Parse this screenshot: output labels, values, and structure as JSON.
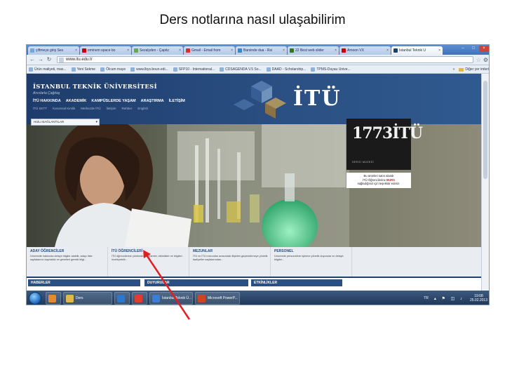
{
  "slide": {
    "title": "Ders notlarına nasıl ulaşabilirim"
  },
  "browser": {
    "tabs": [
      {
        "label": "çiftmeye giriş Ses",
        "icon_color": "#6fa8dc",
        "active": false
      },
      {
        "label": "eminem space bo",
        "icon_color": "#cc0000",
        "active": false
      },
      {
        "label": "Sezalyden - Çapitz",
        "icon_color": "#6aa84f",
        "active": false
      },
      {
        "label": "Gmail - Email from",
        "icon_color": "#d93025",
        "active": false
      },
      {
        "label": "Barsinde dua - Rsi",
        "icon_color": "#3d85c6",
        "active": false
      },
      {
        "label": "22 Best web slider",
        "icon_color": "#38761d",
        "active": false
      },
      {
        "label": "Amoon VX",
        "icon_color": "#cc0000",
        "active": false
      },
      {
        "label": "İstanbul Teknik Ü",
        "icon_color": "#1f3f6e",
        "active": true
      }
    ],
    "url": "www.itu.edu.tr",
    "bookmarks": [
      "Ürün maliyeti, mas...",
      "Yeni Sekme",
      "Ölcum maye",
      "www.lbys.boun.edi...",
      "SFP10 - International...",
      "CDSAGENDA V.5 So...",
      "DAAD - Scholarship...",
      "TPMS-Duyau Unive..."
    ],
    "bookmarks_more": "Diğer yer imleri"
  },
  "site": {
    "name": "İSTANBUL TEKNİK ÜNİVERSİTESİ",
    "subtitle": "Arıcılarla Çağdaş",
    "nav": [
      "İTÜ HAKKINDA",
      "AKADEMİK",
      "KAMPÜSLERDE YAŞAM",
      "ARAŞTIRMA",
      "İLETİŞİM"
    ],
    "subnav": [
      "İTÜ SKTT",
      "Kurumsal Kimlik",
      "Merkezde İTÜ",
      "İletişim",
      "Rehber",
      "English"
    ],
    "logo_text": "İTÜ",
    "quicklinks_label": "HIZLI BAĞLANTILAR",
    "poster": {
      "number": "1773İTÜ",
      "caption": "SERGİ MÜZESİ",
      "note_line1": "Bu ürünleri satın alarak",
      "note_line2_prefix": "İTÜ Öğrencilerine ",
      "note_accent": "BURS",
      "note_line3": "sağladığınız için teşekkür ederiz."
    },
    "cards": [
      {
        "title": "ADAY ÖĞRENCİLER",
        "text": "Üniversite hakkında detaylı bilgiler alabilir, adayı liste sayfalarının kaynaklık ve genelleri gerekli bilgi..."
      },
      {
        "title": "İTÜ ÖĞRENCİLERİ",
        "text": "İTÜ öğrencilerine yönlendirilen öneriler, etkinlikler ve bilgileri inceleyebilir..."
      },
      {
        "title": "MEZUNLAR",
        "text": "İTÜ ve İTÜ mezunları arasındaki ilişkileri güçlendirmeye yönelik faaliyetler sayfalarından..."
      },
      {
        "title": "PERSONEL",
        "text": "Üniversite personelinin işlerine yönelik duyurular ve detaylı bilgiler..."
      }
    ],
    "sections": [
      "HABERLER",
      "DUYURULAR",
      "ETKİNLİKLER"
    ]
  },
  "taskbar": {
    "items": [
      {
        "label": "",
        "icon_color": "#e58a2d"
      },
      {
        "label": "Ders",
        "icon_color": "#e0b84c"
      },
      {
        "label": "",
        "icon_color": "#2b78d0"
      },
      {
        "label": "",
        "icon_color": "#e33b2e"
      },
      {
        "label": "İstanbul Teknik Ü...",
        "icon_color": "#3a7ed8"
      },
      {
        "label": "Microsoft PowerP...",
        "icon_color": "#d04423"
      }
    ],
    "lang": "TR",
    "time": "19:08",
    "date": "25.02.2013"
  },
  "colors": {
    "accent": "#1f3f6e",
    "annotation_arrow": "#e02020"
  }
}
